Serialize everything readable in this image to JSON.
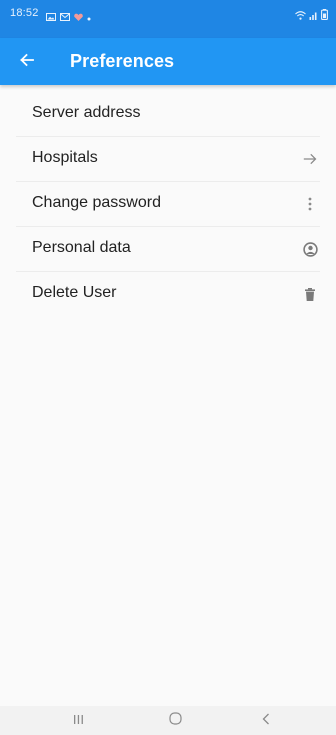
{
  "status_bar": {
    "time": "18:52",
    "left_icons": [
      "gallery-icon",
      "mail-icon",
      "shield-icon",
      "dot-icon"
    ],
    "right_icons": [
      "wifi-icon",
      "signal-icon",
      "battery-icon"
    ]
  },
  "app_bar": {
    "title": "Preferences",
    "back_icon": "arrow-back-icon",
    "background": "#2196f3"
  },
  "preferences": [
    {
      "label": "Server address",
      "icon": ""
    },
    {
      "label": "Hospitals",
      "icon": "arrow-forward-icon"
    },
    {
      "label": "Change password",
      "icon": "more-vertical-icon"
    },
    {
      "label": "Personal data",
      "icon": "account-circle-icon"
    },
    {
      "label": "Delete User",
      "icon": "trash-icon"
    }
  ],
  "nav_bar": {
    "buttons": [
      "recent-apps-icon",
      "home-icon",
      "back-icon"
    ]
  }
}
